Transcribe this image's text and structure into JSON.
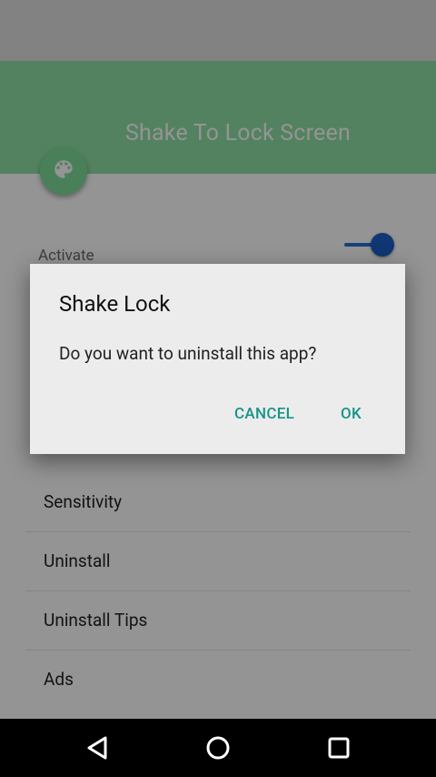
{
  "app": {
    "title": "Shake To Lock Screen"
  },
  "settings": {
    "activate_label": "Activate",
    "list": [
      {
        "label": "Sensitivity"
      },
      {
        "label": "Uninstall"
      },
      {
        "label": "Uninstall Tips"
      },
      {
        "label": "Ads"
      }
    ]
  },
  "dialog": {
    "title": "Shake Lock",
    "message": "Do you want to uninstall this app?",
    "cancel_label": "CANCEL",
    "ok_label": "OK"
  },
  "icons": {
    "fab": "palette-icon",
    "nav_back": "back-icon",
    "nav_home": "home-icon",
    "nav_recents": "recents-icon"
  },
  "colors": {
    "appbar": "#8ee0a6",
    "accent": "#159488",
    "switch": "#1c5fc7"
  }
}
